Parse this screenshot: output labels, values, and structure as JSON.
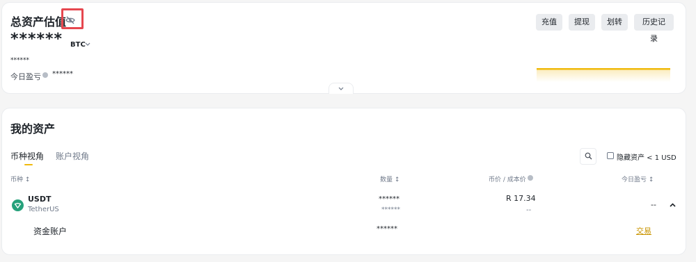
{
  "overview": {
    "title": "总资产估值",
    "balance_masked": "******",
    "unit": "BTC",
    "fiat_masked": "******",
    "pnl_label": "今日盈亏",
    "pnl_masked": "******",
    "buttons": [
      "充值",
      "提现",
      "划转",
      "历史记录"
    ]
  },
  "assets": {
    "title": "我的资产",
    "tabs": [
      "币种视角",
      "账户视角"
    ],
    "hide_small_label": "隐藏资产 < 1 USD",
    "columns": [
      "币种",
      "数量",
      "币价 / 成本价",
      "今日盈亏"
    ],
    "rows": [
      {
        "symbol": "USDT",
        "name": "TetherUS",
        "amount_masked": "******",
        "amount_sub_masked": "******",
        "price": "R 17.34",
        "cost_price": "--",
        "pnl": "--",
        "sub_rows": [
          {
            "account": "资金账户",
            "amount_masked": "******",
            "action": "交易"
          }
        ]
      }
    ]
  },
  "colors": {
    "accent": "#f0b90b",
    "highlight_box": "#e6474f",
    "link": "#c99400",
    "usdt_green": "#26a17b"
  },
  "icons": [
    "eye-slash-icon",
    "chevron-down-icon",
    "info-icon",
    "search-icon",
    "usdt-icon",
    "chevron-up-icon"
  ]
}
